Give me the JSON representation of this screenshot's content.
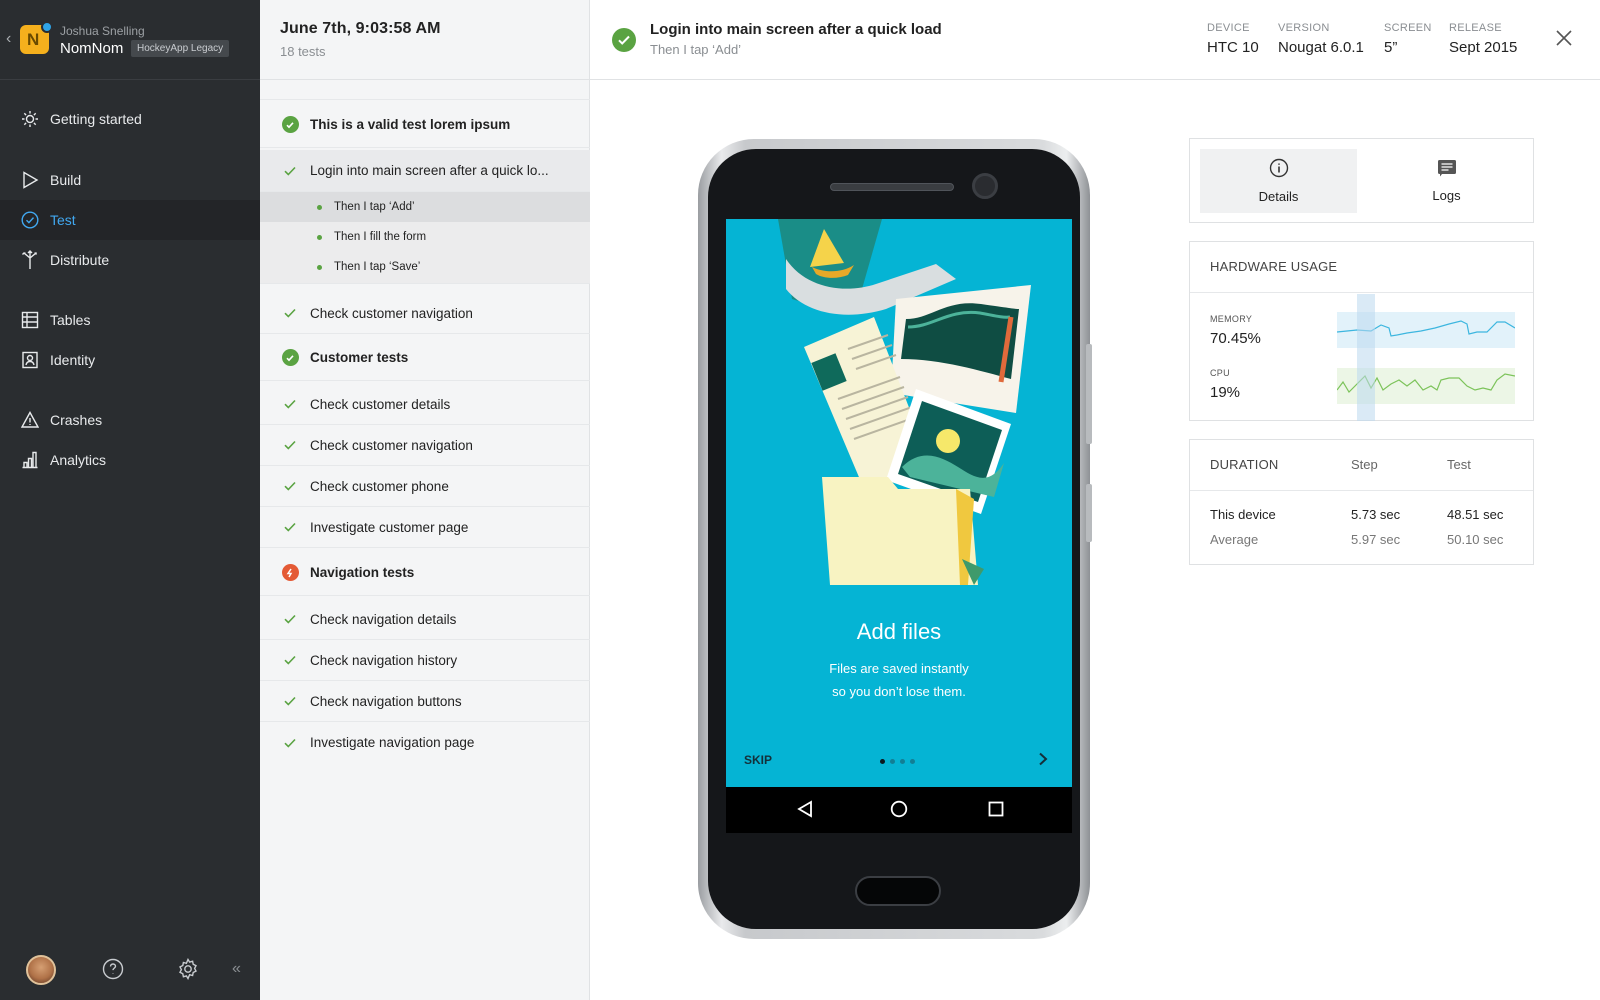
{
  "nav": {
    "user": "Joshua Snelling",
    "app_name": "NomNom",
    "app_tag": "HockeyApp Legacy",
    "app_letter": "N",
    "items": [
      {
        "label": "Getting started",
        "icon": "sun-icon"
      },
      {
        "label": "Build",
        "icon": "play-icon"
      },
      {
        "label": "Test",
        "icon": "check-circle-icon",
        "active": true
      },
      {
        "label": "Distribute",
        "icon": "fork-arrows-icon"
      },
      {
        "label": "Tables",
        "icon": "table-icon"
      },
      {
        "label": "Identity",
        "icon": "id-card-icon"
      },
      {
        "label": "Crashes",
        "icon": "warning-icon"
      },
      {
        "label": "Analytics",
        "icon": "bar-chart-icon"
      }
    ]
  },
  "list": {
    "date": "June 7th, 9:03:58 AM",
    "count": "18 tests",
    "rows": [
      {
        "label": "This is a valid test lorem ipsum",
        "kind": "group",
        "status": "pass"
      },
      {
        "label": "Login into main screen after a quick lo...",
        "kind": "test",
        "status": "pass"
      },
      {
        "label": "Check customer navigation",
        "kind": "test",
        "status": "pass"
      },
      {
        "label": "Customer tests",
        "kind": "group",
        "status": "pass"
      },
      {
        "label": "Check customer details",
        "kind": "test",
        "status": "pass"
      },
      {
        "label": "Check customer navigation",
        "kind": "test",
        "status": "pass"
      },
      {
        "label": "Check customer phone",
        "kind": "test",
        "status": "pass"
      },
      {
        "label": "Investigate customer page",
        "kind": "test",
        "status": "pass"
      },
      {
        "label": "Navigation tests",
        "kind": "group",
        "status": "fail"
      },
      {
        "label": "Check navigation details",
        "kind": "test",
        "status": "pass"
      },
      {
        "label": "Check navigation history",
        "kind": "test",
        "status": "pass"
      },
      {
        "label": "Check navigation buttons",
        "kind": "test",
        "status": "pass"
      },
      {
        "label": "Investigate navigation page",
        "kind": "test",
        "status": "pass"
      }
    ],
    "steps": [
      {
        "label": "Then I tap ‘Add’",
        "active": true
      },
      {
        "label": "Then I fill the form"
      },
      {
        "label": "Then I tap ‘Save’"
      }
    ]
  },
  "header": {
    "title": "Login into main screen after a quick load",
    "subtitle": "Then I tap ‘Add’",
    "meta": [
      {
        "key": "DEVICE",
        "value": "HTC 10"
      },
      {
        "key": "VERSION",
        "value": "Nougat 6.0.1"
      },
      {
        "key": "SCREEN",
        "value": "5”"
      },
      {
        "key": "RELEASE",
        "value": "Sept 2015"
      }
    ]
  },
  "device_screen": {
    "title": "Add files",
    "subtitle_line1": "Files are saved instantly",
    "subtitle_line2": "so you don’t lose them.",
    "skip": "SKIP",
    "page_count": 4,
    "current_page": 1
  },
  "tabs": [
    {
      "label": "Details",
      "icon": "info-icon",
      "active": true
    },
    {
      "label": "Logs",
      "icon": "logs-icon"
    }
  ],
  "hardware": {
    "title": "HARDWARE USAGE",
    "memory_label": "MEMORY",
    "memory_value": "70.45%",
    "cpu_label": "CPU",
    "cpu_value": "19%"
  },
  "duration": {
    "title": "DURATION",
    "col_step": "Step",
    "col_test": "Test",
    "rows": [
      {
        "label": "This device",
        "step": "5.73 sec",
        "test": "48.51 sec"
      },
      {
        "label": "Average",
        "step": "5.97 sec",
        "test": "50.10 sec"
      }
    ]
  },
  "colors": {
    "nav_bg": "#2a2d30",
    "accent": "#41a8f0",
    "pass": "#5aa342",
    "fail": "#e45a35",
    "screen_bg": "#05b4d4",
    "memory_line": "#3cb6df",
    "cpu_line": "#7cc35a"
  }
}
